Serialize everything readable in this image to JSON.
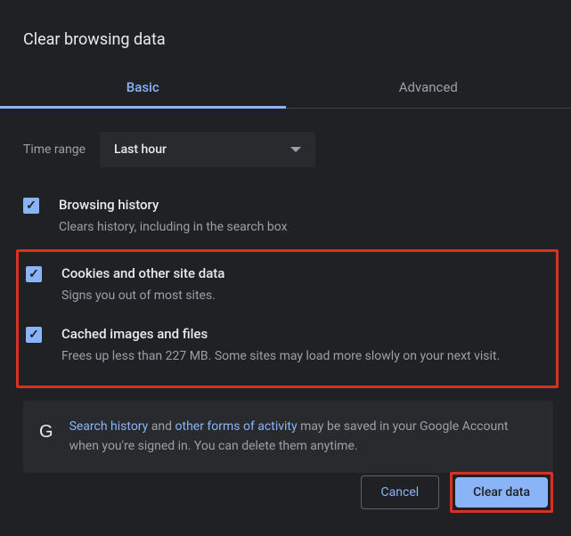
{
  "dialog": {
    "title": "Clear browsing data"
  },
  "tabs": {
    "basic": "Basic",
    "advanced": "Advanced"
  },
  "timeRange": {
    "label": "Time range",
    "value": "Last hour"
  },
  "options": {
    "browsingHistory": {
      "title": "Browsing history",
      "desc": "Clears history, including in the search box"
    },
    "cookies": {
      "title": "Cookies and other site data",
      "desc": "Signs you out of most sites."
    },
    "cachedImages": {
      "title": "Cached images and files",
      "desc": "Frees up less than 227 MB. Some sites may load more slowly on your next visit."
    }
  },
  "infoPanel": {
    "link1": "Search history",
    "mid1": " and ",
    "link2": "other forms of activity",
    "rest": " may be saved in your Google Account when you're signed in. You can delete them anytime."
  },
  "buttons": {
    "cancel": "Cancel",
    "clear": "Clear data"
  }
}
